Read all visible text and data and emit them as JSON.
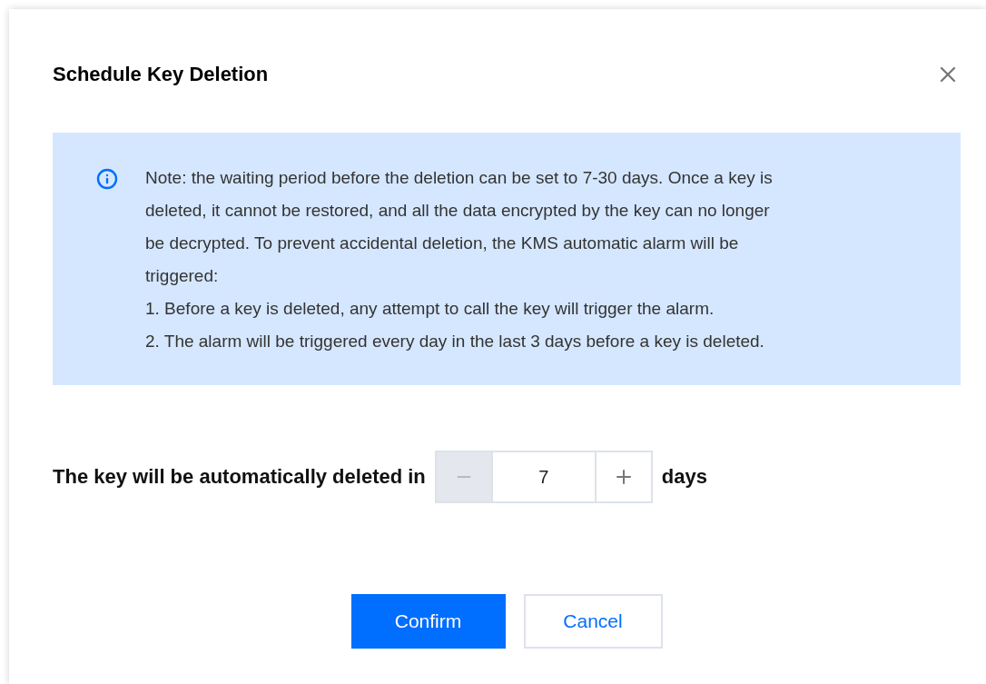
{
  "dialog": {
    "title": "Schedule Key Deletion"
  },
  "note": {
    "paragraph": "Note: the waiting period before the deletion can be set to 7-30 days. Once a key is deleted, it cannot be restored, and all the data encrypted by the key can no longer be decrypted. To prevent accidental deletion, the KMS automatic alarm will be triggered:",
    "items": [
      "1. Before a key is deleted, any attempt to call the key will trigger the alarm.",
      "2. The alarm will be triggered every day in the last 3 days before a key is deleted."
    ]
  },
  "period": {
    "label": "The key will be automatically deleted in",
    "value": "7",
    "decrement_disabled": true,
    "increment_disabled": false,
    "unit": "days"
  },
  "buttons": [
    {
      "label": "Confirm",
      "kind": "primary"
    },
    {
      "label": "Cancel",
      "kind": "secondary"
    }
  ]
}
